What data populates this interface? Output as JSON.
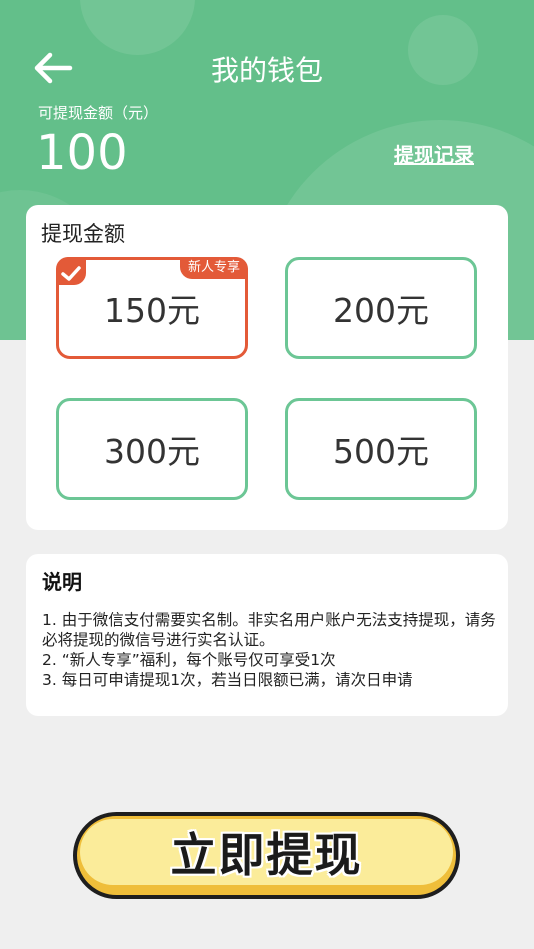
{
  "header": {
    "title": "我的钱包",
    "balance_label": "可提现金额（元）",
    "balance_value": "100",
    "history_link": "提现记录"
  },
  "amounts": {
    "title": "提现金额",
    "options": [
      {
        "label": "150元",
        "badge": "新人专享",
        "selected": true
      },
      {
        "label": "200元",
        "selected": false
      },
      {
        "label": "300元",
        "selected": false
      },
      {
        "label": "500元",
        "selected": false
      }
    ]
  },
  "notes": {
    "title": "说明",
    "lines": [
      "1. 由于微信支付需要实名制。非实名用户账户无法支持提现，请务必将提现的微信号进行实名认证。",
      "2. “新人专享”福利，每个账号仅可享受1次",
      "3. 每日可申请提现1次，若当日限额已满，请次日申请"
    ]
  },
  "cta": {
    "label": "立即提现"
  },
  "colors": {
    "brand_green": "#63bf8a",
    "option_border": "#6cc695",
    "selected_red": "#e35a38",
    "button_yellow": "#fbec9a"
  }
}
